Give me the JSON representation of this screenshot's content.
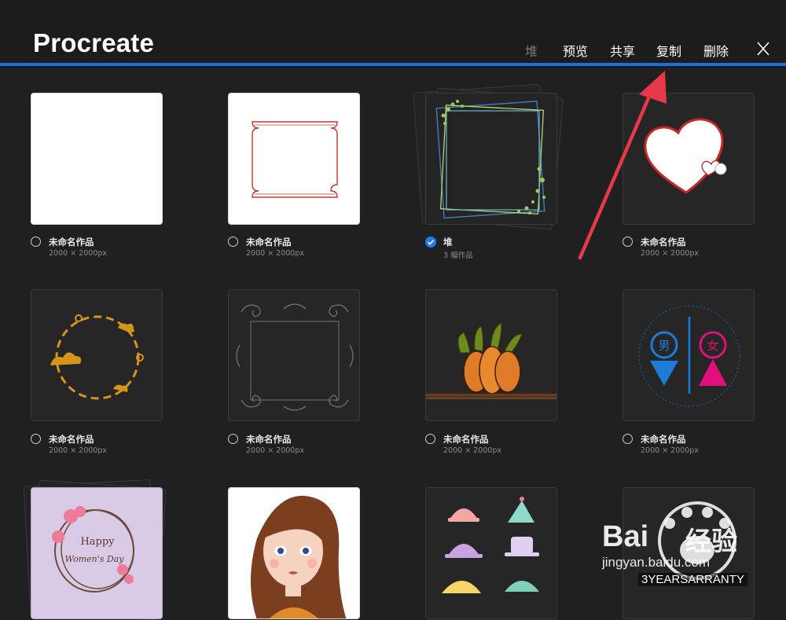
{
  "header": {
    "title": "Procreate",
    "menu": [
      "堆",
      "预览",
      "共享",
      "复制",
      "删除"
    ]
  },
  "colors": {
    "accent": "#1d6fd6",
    "arrow": "#e8394a",
    "background": "#202020"
  },
  "gallery": {
    "items": [
      {
        "label": "未命名作品",
        "size": "2000 × 2000px",
        "selected": false
      },
      {
        "label": "未命名作品",
        "size": "2000 × 2000px",
        "selected": false
      },
      {
        "label": "堆",
        "size": "3 幅作品",
        "selected": true
      },
      {
        "label": "未命名作品",
        "size": "2000 × 2000px",
        "selected": false
      },
      {
        "label": "未命名作品",
        "size": "2000 × 2000px",
        "selected": false
      },
      {
        "label": "未命名作品",
        "size": "2000 × 2000px",
        "selected": false
      },
      {
        "label": "未命名作品",
        "size": "2000 × 2000px",
        "selected": false
      },
      {
        "label": "未命名作品",
        "size": "2000 × 2000px",
        "selected": false
      }
    ],
    "artwork_text": {
      "happy": "Happy",
      "womens_day": "Women's Day",
      "male": "男",
      "female": "女"
    }
  },
  "watermark": {
    "brand": "Bai",
    "brand_cn": "经验",
    "url": "jingyan.baidu.com",
    "badge": "3YEARSARRANTY"
  }
}
